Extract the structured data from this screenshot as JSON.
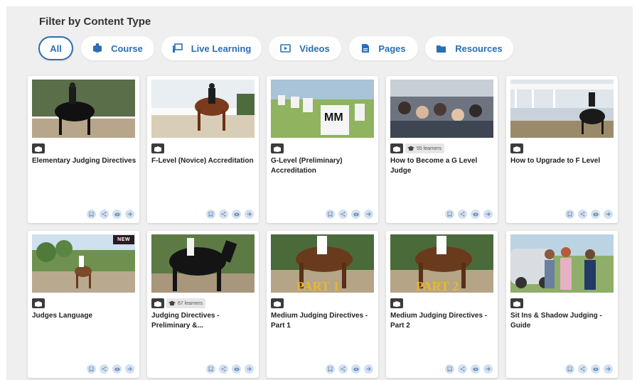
{
  "heading": "Filter by Content Type",
  "filters": [
    {
      "label": "All",
      "icon": "none",
      "active": true
    },
    {
      "label": "Course",
      "icon": "course-icon"
    },
    {
      "label": "Live Learning",
      "icon": "presenter-icon"
    },
    {
      "label": "Videos",
      "icon": "video-icon"
    },
    {
      "label": "Pages",
      "icon": "document-icon"
    },
    {
      "label": "Resources",
      "icon": "folder-icon"
    }
  ],
  "cards": [
    {
      "title": "Elementary Judging Directives",
      "learners": null,
      "badge": null
    },
    {
      "title": "F-Level (Novice) Accreditation",
      "learners": null,
      "badge": null
    },
    {
      "title": "G-Level (Preliminary) Accreditation",
      "learners": null,
      "badge": null
    },
    {
      "title": "How to Become a G Level Judge",
      "learners": "55 learners",
      "badge": null
    },
    {
      "title": "How to Upgrade to F Level",
      "learners": null,
      "badge": null
    },
    {
      "title": "Judges Language",
      "learners": null,
      "badge": "NEW"
    },
    {
      "title": "Judging Directives - Preliminary &...",
      "learners": "67 learners",
      "badge": null
    },
    {
      "title": "Medium Judging Directives - Part 1",
      "learners": null,
      "badge": null,
      "overlay": "PART 1"
    },
    {
      "title": "Medium Judging Directives - Part 2",
      "learners": null,
      "badge": null,
      "overlay": "PART 2"
    },
    {
      "title": "Sit Ins & Shadow Judging - Guide",
      "learners": null,
      "badge": null
    }
  ],
  "colors": {
    "accent": "#2a6fb5",
    "panel": "#efefef"
  }
}
